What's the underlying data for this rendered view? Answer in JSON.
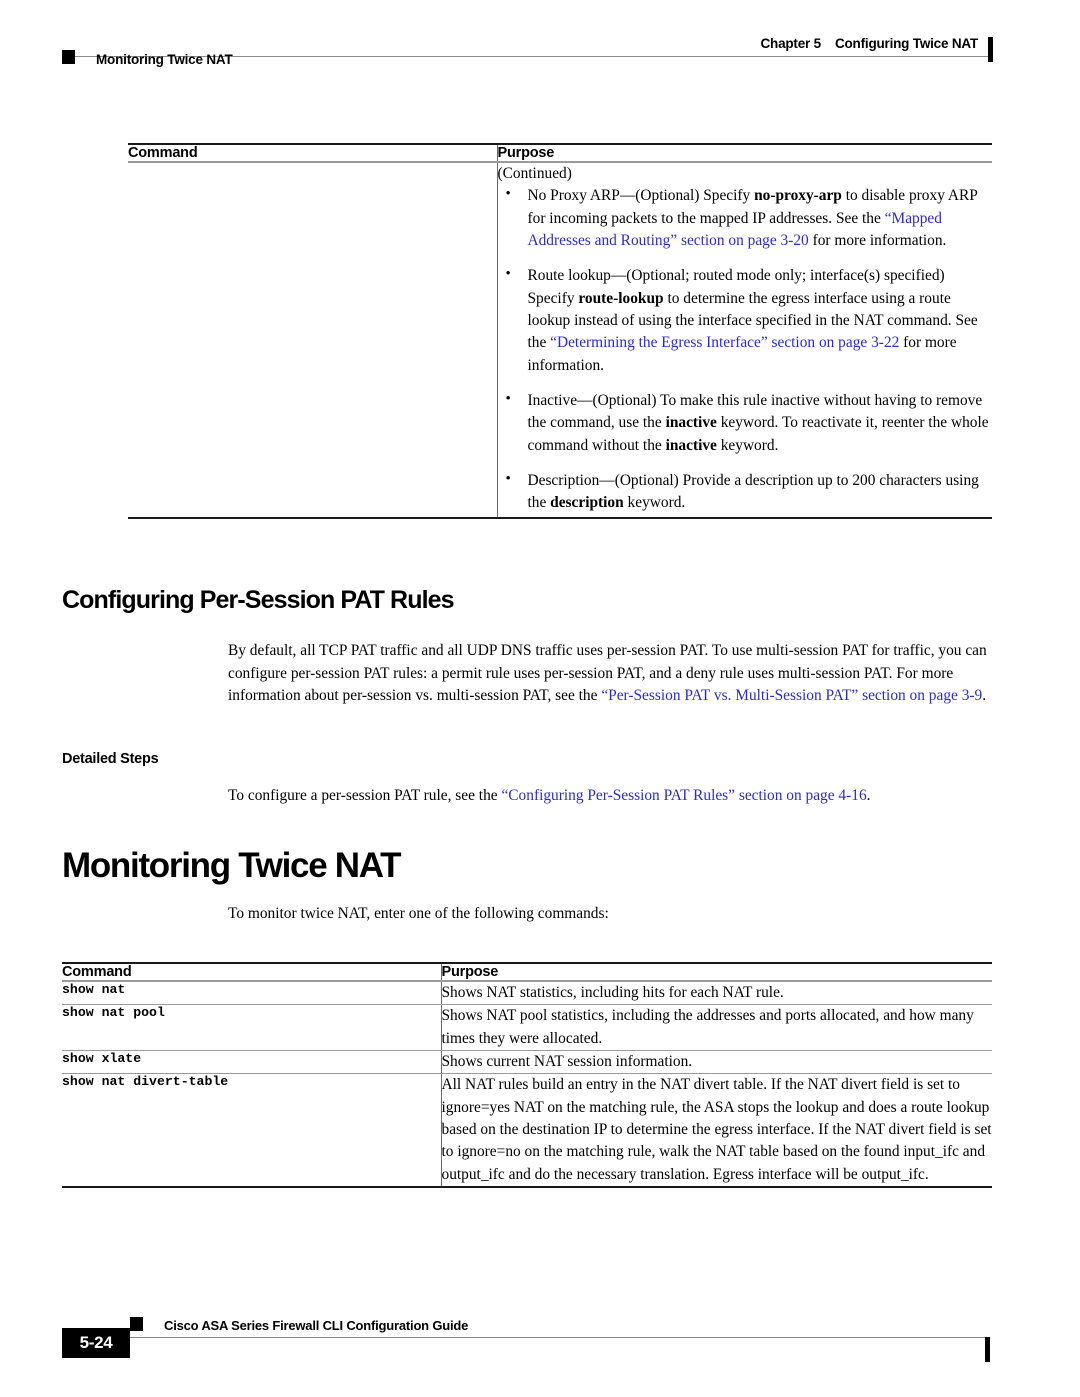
{
  "header": {
    "chapter": "Chapter 5",
    "chapter_title": "Configuring Twice NAT",
    "section": "Monitoring Twice NAT"
  },
  "table_top": {
    "columns": [
      "Command",
      "Purpose"
    ],
    "continued_label": "(Continued)",
    "bullets": [
      {
        "id": "no-proxy-arp",
        "segments": [
          {
            "t": "No Proxy ARP—(Optional) Specify ",
            "s": "plain"
          },
          {
            "t": "no-proxy-arp",
            "s": "bold"
          },
          {
            "t": " to disable proxy ARP for incoming packets to the mapped IP addresses. See the ",
            "s": "plain"
          },
          {
            "t": "“Mapped Addresses and Routing” section on page 3-20",
            "s": "link"
          },
          {
            "t": " for more information.",
            "s": "plain"
          }
        ]
      },
      {
        "id": "route-lookup",
        "segments": [
          {
            "t": "Route lookup—(Optional; routed mode only; interface(s) specified) Specify ",
            "s": "plain"
          },
          {
            "t": "route-lookup",
            "s": "bold"
          },
          {
            "t": " to determine the egress interface using a route lookup instead of using the interface specified in the NAT command. See the ",
            "s": "plain"
          },
          {
            "t": "“Determining the Egress Interface” section on page 3-22",
            "s": "link"
          },
          {
            "t": " for more information.",
            "s": "plain"
          }
        ]
      },
      {
        "id": "inactive",
        "segments": [
          {
            "t": "Inactive—(Optional) To make this rule inactive without having to remove the command, use the ",
            "s": "plain"
          },
          {
            "t": "inactive",
            "s": "bold"
          },
          {
            "t": " keyword. To reactivate it, reenter the whole command without the ",
            "s": "plain"
          },
          {
            "t": "inactive",
            "s": "bold"
          },
          {
            "t": " keyword.",
            "s": "plain"
          }
        ]
      },
      {
        "id": "description",
        "segments": [
          {
            "t": "Description—(Optional) Provide a description up to 200 characters using the ",
            "s": "plain"
          },
          {
            "t": "description",
            "s": "bold"
          },
          {
            "t": " keyword.",
            "s": "plain"
          }
        ]
      }
    ]
  },
  "section_pat": {
    "heading": "Configuring Per-Session PAT Rules",
    "paragraph": [
      {
        "t": "By default, all TCP PAT traffic and all UDP DNS traffic uses per-session PAT. To use multi-session PAT for traffic, you can configure per-session PAT rules: a permit rule uses per-session PAT, and a deny rule uses multi-session PAT. For more information about per-session vs. multi-session PAT, see the ",
        "s": "plain"
      },
      {
        "t": "“Per-Session PAT vs. Multi-Session PAT” section on page 3-9",
        "s": "link"
      },
      {
        "t": ".",
        "s": "plain"
      }
    ],
    "detailed_steps_heading": "Detailed Steps",
    "detailed_steps_paragraph": [
      {
        "t": "To configure a per-session PAT rule, see the ",
        "s": "plain"
      },
      {
        "t": "“Configuring Per-Session PAT Rules” section on page 4-16",
        "s": "link"
      },
      {
        "t": ".",
        "s": "plain"
      }
    ]
  },
  "section_monitoring": {
    "heading": "Monitoring Twice NAT",
    "intro": "To monitor twice NAT, enter one of the following commands:"
  },
  "table_monitor": {
    "columns": [
      "Command",
      "Purpose"
    ],
    "rows": [
      {
        "command": "show nat",
        "purpose": "Shows NAT statistics, including hits for each NAT rule."
      },
      {
        "command": "show nat pool",
        "purpose": "Shows NAT pool statistics, including the addresses and ports allocated, and how many times they were allocated."
      },
      {
        "command": "show xlate",
        "purpose": "Shows current NAT session information."
      },
      {
        "command": "show nat divert-table",
        "purpose": "All NAT rules build an entry in the NAT divert table. If the NAT divert field is set to ignore=yes NAT on the matching rule, the ASA stops the lookup and does a route lookup based on the destination IP to determine the egress interface. If the NAT divert field is set to ignore=no on the matching rule, walk the NAT table based on the found input_ifc and output_ifc and do the necessary translation. Egress interface will be output_ifc."
      }
    ]
  },
  "footer": {
    "guide_title": "Cisco ASA Series Firewall CLI Configuration Guide",
    "page_number": "5-24"
  },
  "colors": {
    "link": "#2b2bd4",
    "rule_dark": "#1a1a1a",
    "rule_light": "#9a9a9a"
  }
}
